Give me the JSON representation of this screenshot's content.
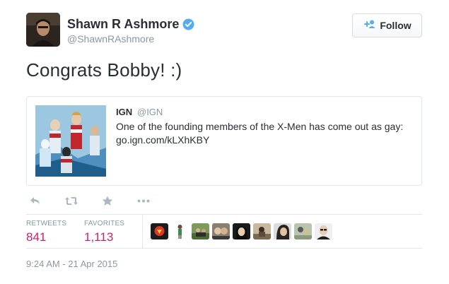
{
  "user": {
    "display_name": "Shawn R Ashmore",
    "handle": "@ShawnRAshmore",
    "verified": true,
    "avatar_icon": "profile-photo"
  },
  "follow": {
    "label": "Follow",
    "icon": "add-person-icon"
  },
  "tweet": {
    "text": "Congrats Bobby! :)"
  },
  "quoted": {
    "name": "IGN",
    "handle": "@IGN",
    "text": "One of the founding members of the X-Men has come out as gay: go.ign.com/kLXhKBY",
    "image_icon": "comic-thumbnail"
  },
  "actions": [
    {
      "icon": "reply-icon"
    },
    {
      "icon": "retweet-icon"
    },
    {
      "icon": "favorite-star-icon"
    },
    {
      "icon": "more-dots-icon"
    }
  ],
  "stats": {
    "retweets_label": "RETWEETS",
    "retweets_value": "841",
    "favorites_label": "FAVORITES",
    "favorites_value": "1,113"
  },
  "favoriters": [
    {
      "icon": "avatar-1"
    },
    {
      "icon": "avatar-2"
    },
    {
      "icon": "avatar-3"
    },
    {
      "icon": "avatar-4"
    },
    {
      "icon": "avatar-5"
    },
    {
      "icon": "avatar-6"
    },
    {
      "icon": "avatar-7"
    },
    {
      "icon": "avatar-8"
    },
    {
      "icon": "avatar-9"
    }
  ],
  "timestamp": "9:24 AM - 21 Apr 2015",
  "colors": {
    "accent": "#d0216a",
    "verified": "#55acee",
    "muted": "#8899a6"
  }
}
